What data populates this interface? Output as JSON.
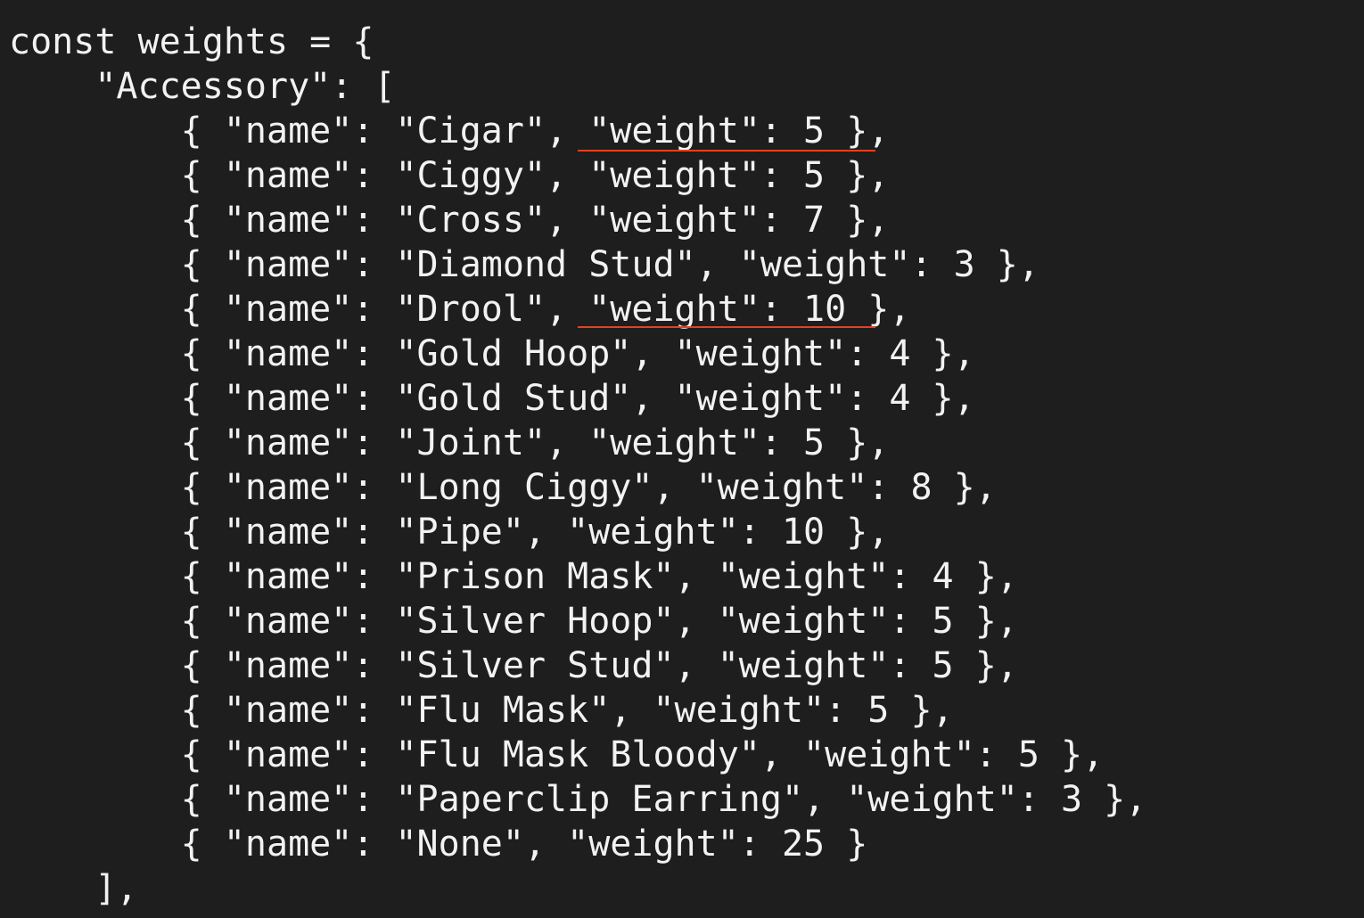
{
  "editor": {
    "lines": [
      "const weights = {",
      "    \"Accessory\": [",
      "        { \"name\": \"Cigar\", \"weight\": 5 },",
      "        { \"name\": \"Ciggy\", \"weight\": 5 },",
      "        { \"name\": \"Cross\", \"weight\": 7 },",
      "        { \"name\": \"Diamond Stud\", \"weight\": 3 },",
      "        { \"name\": \"Drool\", \"weight\": 10 },",
      "        { \"name\": \"Gold Hoop\", \"weight\": 4 },",
      "        { \"name\": \"Gold Stud\", \"weight\": 4 },",
      "        { \"name\": \"Joint\", \"weight\": 5 },",
      "        { \"name\": \"Long Ciggy\", \"weight\": 8 },",
      "        { \"name\": \"Pipe\", \"weight\": 10 },",
      "        { \"name\": \"Prison Mask\", \"weight\": 4 },",
      "        { \"name\": \"Silver Hoop\", \"weight\": 5 },",
      "        { \"name\": \"Silver Stud\", \"weight\": 5 },",
      "        { \"name\": \"Flu Mask\", \"weight\": 5 },",
      "        { \"name\": \"Flu Mask Bloody\", \"weight\": 5 },",
      "        { \"name\": \"Paperclip Earring\", \"weight\": 3 },",
      "        { \"name\": \"None\", \"weight\": 25 }",
      "    ],"
    ]
  },
  "colors": {
    "background": "#1e1e1e",
    "text": "#f2f2f2",
    "error_squiggle": "#e2421f"
  }
}
